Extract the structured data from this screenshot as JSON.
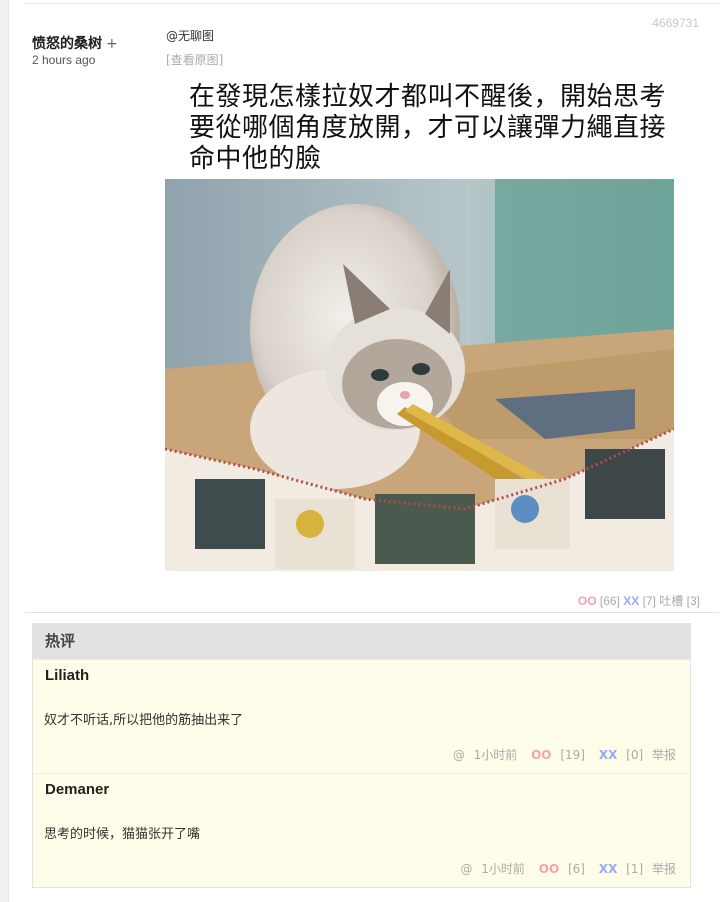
{
  "post": {
    "id": "4669731",
    "author": "愤怒的桑树",
    "author_plus": "+",
    "time": "2 hours ago",
    "wuliao_tag": "@无聊图",
    "view_original": "[查看原图]",
    "caption": "在發現怎樣拉奴才都叫不醒後，開始思考要從哪個角度放開，才可以讓彈力繩直接命中他的臉",
    "votes": {
      "oo_label": "OO",
      "oo_count": "[66]",
      "xx_label": "XX",
      "xx_count": "[7]",
      "tucao_label": "吐槽",
      "tucao_count": "[3]"
    }
  },
  "hot_comments": {
    "title": "热评",
    "items": [
      {
        "name": "Liliath",
        "text": "奴才不听话,所以把他的筋抽出来了",
        "at": "@",
        "time": "1小时前",
        "oo_label": "OO",
        "oo_count": "[19]",
        "xx_label": "XX",
        "xx_count": "[0]",
        "report": "举报"
      },
      {
        "name": "Demaner",
        "text": "思考的时候，猫猫张开了嘴",
        "at": "@",
        "time": "1小时前",
        "oo_label": "OO",
        "oo_count": "[6]",
        "xx_label": "XX",
        "xx_count": "[1]",
        "report": "举报"
      }
    ]
  },
  "colors": {
    "oo": "#f4a3ad",
    "xx": "#9aa9f5",
    "comment_bg": "#fdfde9",
    "header_bg": "#e2e2e2"
  }
}
